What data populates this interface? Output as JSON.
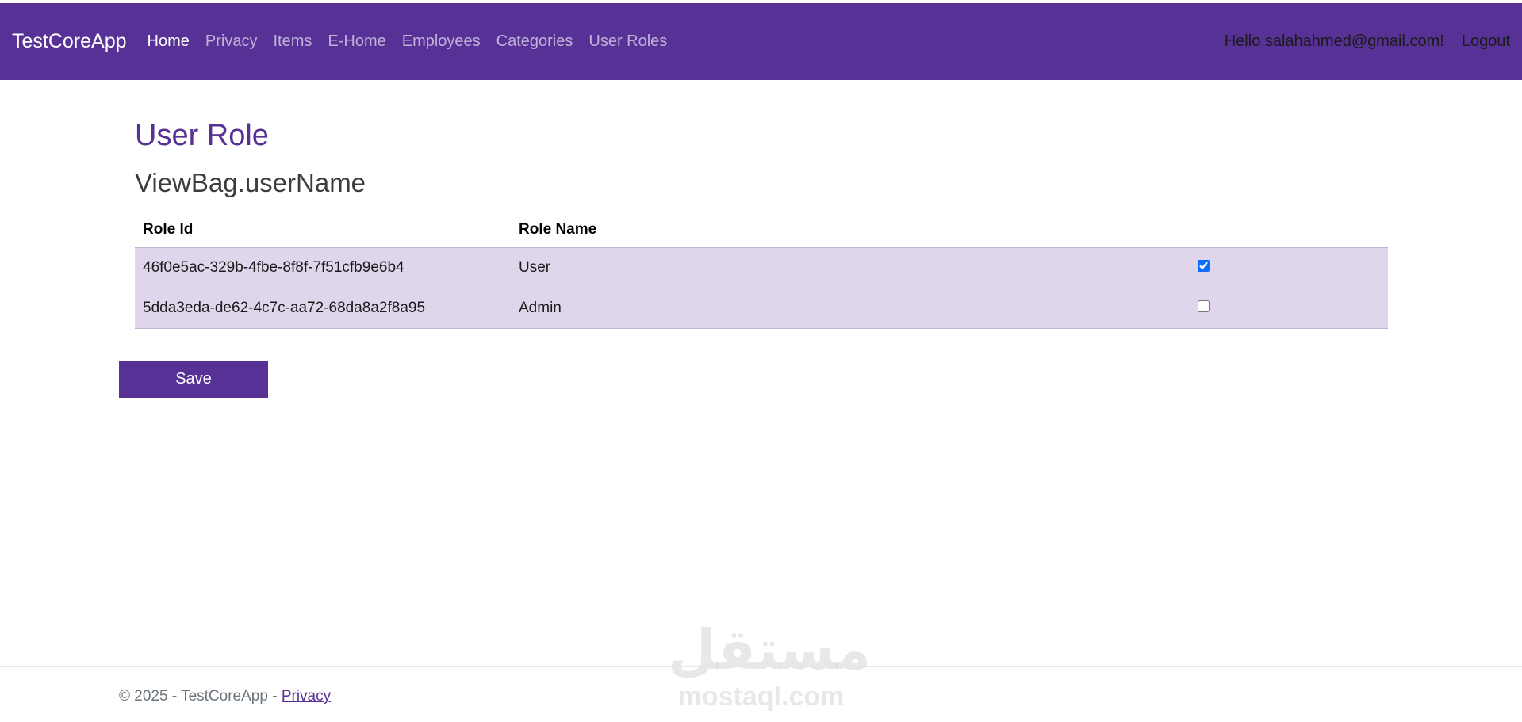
{
  "navbar": {
    "brand": "TestCoreApp",
    "links": [
      {
        "label": "Home",
        "active": true
      },
      {
        "label": "Privacy",
        "active": false
      },
      {
        "label": "Items",
        "active": false
      },
      {
        "label": "E-Home",
        "active": false
      },
      {
        "label": "Employees",
        "active": false
      },
      {
        "label": "Categories",
        "active": false
      },
      {
        "label": "User Roles",
        "active": false
      }
    ],
    "greeting": "Hello salahahmed@gmail.com!",
    "logout": "Logout",
    "background_color": "#573195"
  },
  "page": {
    "title": "User Role",
    "subtitle": "ViewBag.userName"
  },
  "table": {
    "headers": [
      "Role Id",
      "Role Name",
      ""
    ],
    "rows": [
      {
        "role_id": "46f0e5ac-329b-4fbe-8f8f-7f51cfb9e6b4",
        "role_name": "User",
        "checked": true
      },
      {
        "role_id": "5dda3eda-de62-4c7c-aa72-68da8a2f8a95",
        "role_name": "Admin",
        "checked": false
      }
    ]
  },
  "save_button": "Save",
  "footer": {
    "copyright": "© 2025 - TestCoreApp - ",
    "privacy_link": "Privacy"
  },
  "watermark": {
    "arabic": "مستقل",
    "latin": "mostaql.com"
  }
}
